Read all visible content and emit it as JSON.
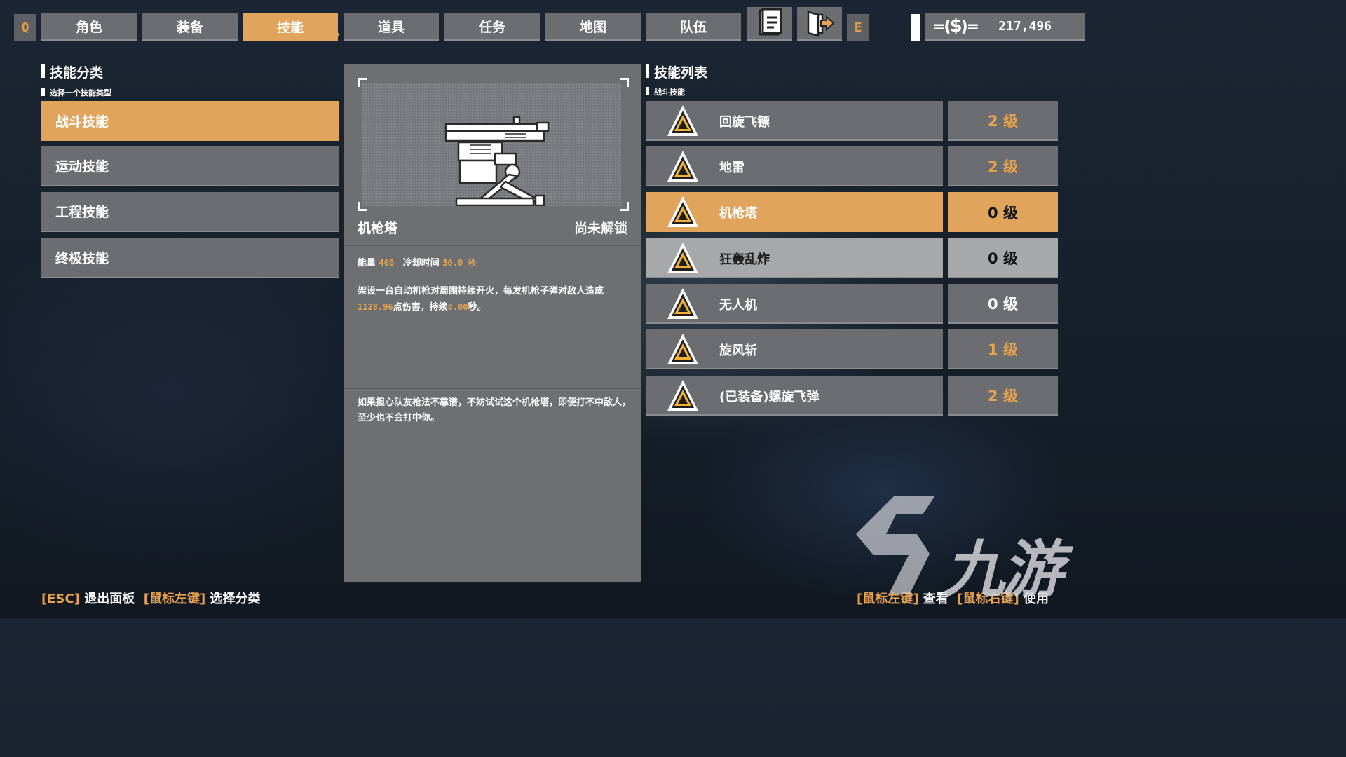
{
  "topbar": {
    "left_key": "Q",
    "right_key": "E",
    "tabs": [
      "角色",
      "装备",
      "技能",
      "道具",
      "任务",
      "地图",
      "队伍"
    ],
    "active_tab": "技能",
    "icons": [
      "notes-icon",
      "exit-door-icon"
    ],
    "currency_amount": "217,496"
  },
  "categories": {
    "title": "技能分类",
    "subtitle": "选择一个技能类型",
    "items": [
      "战斗技能",
      "运动技能",
      "工程技能",
      "终极技能"
    ],
    "active": "战斗技能"
  },
  "detail": {
    "name": "机枪塔",
    "status": "尚未解锁",
    "energy_label": "能量",
    "energy_value": "400",
    "cooldown_label": "冷却时间",
    "cooldown_value": "30.0 秒",
    "desc_part1": "架设一台自动机枪对周围持续开火，每发机枪子弹对敌人造成",
    "desc_damage": "1128.96",
    "desc_part2": "点伤害，持续",
    "desc_duration": "8.00",
    "desc_part3": "秒。",
    "flavor": "如果担心队友枪法不靠谱，不妨试试这个机枪塔，即便打不中敌人，至少也不会打中你。"
  },
  "skills": {
    "title": "技能列表",
    "subtitle": "战斗技能",
    "items": [
      {
        "name": "回旋飞镖",
        "level": "2 级",
        "state": "normal"
      },
      {
        "name": "地雷",
        "level": "2 级",
        "state": "normal"
      },
      {
        "name": "机枪塔",
        "level": "0 级",
        "state": "selected"
      },
      {
        "name": "狂轰乱炸",
        "level": "0 级",
        "state": "hover"
      },
      {
        "name": "无人机",
        "level": "0 级",
        "state": "normal"
      },
      {
        "name": "旋风斩",
        "level": "1 级",
        "state": "normal"
      },
      {
        "name": "(已装备)螺旋飞弹",
        "level": "2 级",
        "state": "normal"
      }
    ]
  },
  "hints": {
    "left": [
      {
        "key": "[ESC]",
        "action": "退出面板"
      },
      {
        "key": "[鼠标左键]",
        "action": "选择分类"
      }
    ],
    "right": [
      {
        "key": "[鼠标左键]",
        "action": "查看"
      },
      {
        "key": "[鼠标右键]",
        "action": "使用"
      }
    ]
  },
  "watermark": {
    "text": "九游"
  },
  "colors": {
    "accent": "#e0a45c",
    "panel": "#6b6d70",
    "highlight_text": "#e6a24f"
  }
}
